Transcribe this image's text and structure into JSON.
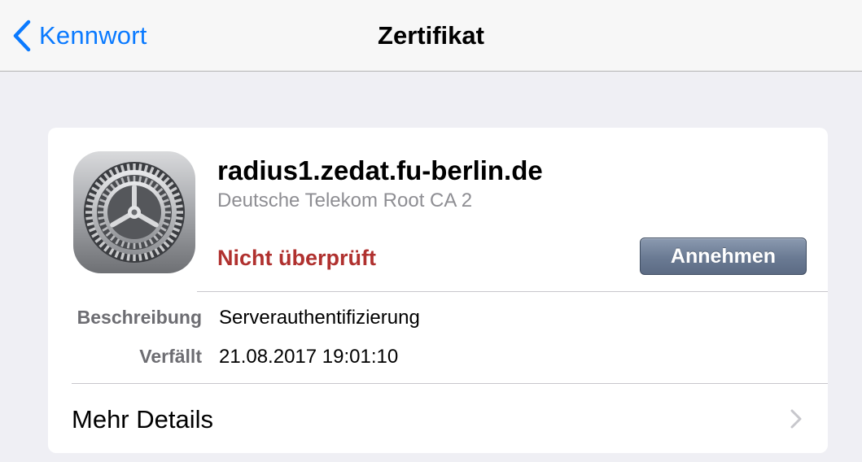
{
  "navbar": {
    "back_label": "Kennwort",
    "title": "Zertifikat"
  },
  "certificate": {
    "icon": "settings-gear-icon",
    "host": "radius1.zedat.fu-berlin.de",
    "issuer": "Deutsche Telekom Root CA 2",
    "status": "Nicht überprüft",
    "accept_label": "Annehmen",
    "details": [
      {
        "label": "Beschreibung",
        "value": "Serverauthentifizierung"
      },
      {
        "label": "Verfällt",
        "value": "21.08.2017 19:01:10"
      }
    ],
    "more_details_label": "Mehr Details"
  },
  "colors": {
    "accent": "#0a7aff",
    "status_untrusted": "#b0312f",
    "background": "#efeff4",
    "button": "#6a7a93"
  }
}
